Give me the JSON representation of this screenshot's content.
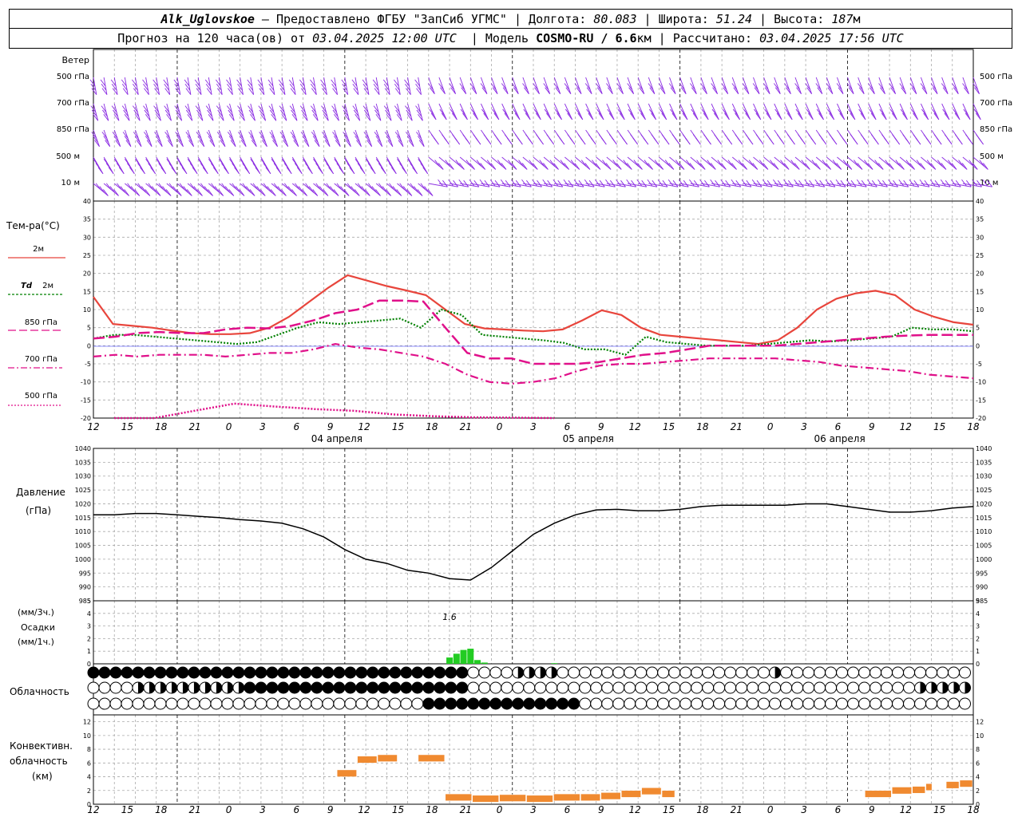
{
  "header": {
    "station": "Alk_Uglovskoe",
    "provider": " – Предоставлено ФГБУ \"ЗапСиб УГМС\" | Долгота: ",
    "lon": "80.083",
    "lat_label": " | Широта: ",
    "lat": "51.24",
    "alt_label": " | Высота: ",
    "alt": "187",
    "alt_unit": "м",
    "forecast_label": "Прогноз на 120 часа(ов) от ",
    "forecast_time": "03.04.2025 12:00 UTC",
    "model_label": "  | Модель ",
    "model": "COSMO-RU / 6.6",
    "model_unit": "км",
    "calc_label": " | Рассчитано: ",
    "calc_time": "03.04.2025 17:56 UTC"
  },
  "labels": {
    "wind": "Ветер",
    "levels": [
      "500 гПа",
      "700 гПа",
      "850 гПа",
      "500 м",
      "10 м"
    ],
    "temp_title": "Тем-ра(°С)",
    "t2m": "2м",
    "td_sym": "Td",
    "td_2m": "2м",
    "t850": "850 гПа",
    "t700": "700 гПа",
    "t500": "500 гПа",
    "pressure": "Давление",
    "pressure_unit": "(гПа)",
    "precip_unit1": "(мм/3ч.)",
    "precip": "Осадки",
    "precip_unit2": "(мм/1ч.)",
    "precip_peak": "1.6",
    "cloud": "Облачность",
    "conv1": "Конвективн.",
    "conv2": "облачность",
    "conv3": "(км)",
    "dates": [
      "04 апреля",
      "05 апреля",
      "06 апреля"
    ],
    "hour_ticks": [
      "12",
      "15",
      "18",
      "21",
      "0",
      "3",
      "6",
      "9",
      "12",
      "15",
      "18",
      "21",
      "0",
      "3",
      "6",
      "9",
      "12",
      "15",
      "18",
      "21",
      "0",
      "3",
      "6",
      "9",
      "12",
      "15",
      "18"
    ]
  },
  "colors": {
    "t2m": "#e8453c",
    "td2m": "#008000",
    "t_upper": "#e0108a",
    "wind": "#8a2be2",
    "precip": "#22cc22",
    "convective": "#f08a30"
  },
  "chart_data": [
    {
      "type": "line",
      "name": "temperature",
      "x_hours": [
        0,
        3,
        6,
        9,
        12,
        15,
        18,
        21,
        24,
        27,
        30,
        33,
        36,
        39,
        42,
        45,
        48,
        51,
        54,
        57,
        60,
        63,
        66,
        69,
        72,
        75,
        78,
        81,
        84,
        87,
        90,
        93,
        96,
        99,
        102,
        105,
        108,
        111,
        114,
        117,
        120,
        123,
        126
      ],
      "series": [
        {
          "name": "2м",
          "values": [
            13.5,
            6,
            5.5,
            5,
            4.2,
            3.5,
            3.2,
            3.2,
            3.5,
            5,
            8,
            12,
            16,
            19.5,
            18,
            16.5,
            15.3,
            14,
            10,
            6,
            4.8,
            4.5,
            4.2,
            4,
            4.5,
            7,
            9.8,
            8.5,
            5,
            3,
            2.5,
            2,
            1.5,
            1,
            0.5,
            1.5,
            5,
            10,
            13,
            14.5,
            15.2,
            14,
            10,
            8,
            6.5,
            5.8
          ]
        },
        {
          "name": "Td 2м",
          "values": [
            2,
            3,
            3,
            2.5,
            2,
            1.5,
            1,
            0.5,
            1,
            3,
            5,
            6.5,
            6,
            6.5,
            7,
            7.5,
            5,
            10,
            8.5,
            3,
            2.5,
            2,
            1.5,
            0.8,
            -1,
            -1,
            -2.5,
            2.5,
            1,
            0.5,
            0,
            0,
            0,
            0.5,
            1,
            1.5,
            1.2,
            1.5,
            2,
            2.5,
            5,
            4.5,
            4.5,
            4
          ]
        },
        {
          "name": "850 гПа",
          "values": [
            2,
            2.5,
            3.5,
            3.8,
            3.5,
            3.5,
            4.5,
            5,
            4.8,
            5.5,
            7,
            9,
            10,
            12.5,
            12.5,
            12.2,
            5,
            -2,
            -3.5,
            -3.5,
            -5,
            -5,
            -5,
            -4.5,
            -3.5,
            -2.5,
            -2,
            -1,
            0,
            0,
            0,
            0,
            0.5,
            1,
            1.5,
            2,
            2.5,
            2.8,
            3,
            3,
            3
          ]
        },
        {
          "name": "700 гПа",
          "values": [
            -3,
            -2.5,
            -3,
            -2.5,
            -2.5,
            -2.5,
            -3,
            -2.5,
            -2,
            -2,
            -1,
            0.5,
            -0.5,
            -1,
            -2,
            -3,
            -5,
            -8,
            -10,
            -10.5,
            -10,
            -9,
            -7,
            -5.5,
            -5,
            -5,
            -4.5,
            -4,
            -3.5,
            -3.5,
            -3.5,
            -3.5,
            -4,
            -4.5,
            -5.5,
            -6,
            -6.5,
            -7,
            -8,
            -8.5,
            -9
          ]
        },
        {
          "name": "500 гПа",
          "values": [
            -20,
            -20,
            -18,
            -16,
            -16.8,
            -17.5,
            -18,
            -19,
            -19.5,
            -19.8,
            -19.9,
            -20
          ]
        }
      ],
      "ylim": [
        -20,
        40
      ],
      "yticks": [
        -20,
        -15,
        -10,
        -5,
        0,
        5,
        10,
        15,
        20,
        25,
        30,
        35,
        40
      ]
    },
    {
      "type": "line",
      "name": "pressure",
      "x_hours": [
        0,
        3,
        6,
        9,
        12,
        15,
        18,
        21,
        24,
        27,
        30,
        33,
        36,
        39,
        42,
        45,
        48,
        51,
        54,
        57,
        60,
        63,
        66,
        69,
        72,
        75,
        78,
        81,
        84,
        87,
        90,
        93,
        96,
        99,
        102,
        105,
        108,
        111,
        114,
        117,
        120,
        123,
        126
      ],
      "values": [
        1016,
        1016,
        1016.5,
        1016.5,
        1016,
        1015.5,
        1015,
        1014.3,
        1013.8,
        1013,
        1011,
        1008,
        1003.5,
        1000,
        998.5,
        996,
        995,
        993,
        992.5,
        997,
        1003,
        1009,
        1013,
        1016,
        1017.8,
        1018,
        1017.5,
        1017.5,
        1018,
        1019,
        1019.5,
        1019.5,
        1019.5,
        1019.5,
        1020,
        1020,
        1019,
        1018,
        1017,
        1017,
        1017.5,
        1018.5,
        1019
      ],
      "ylim": [
        985,
        1040
      ],
      "yticks": [
        985,
        990,
        995,
        1000,
        1005,
        1010,
        1015,
        1020,
        1025,
        1030,
        1035,
        1040
      ]
    },
    {
      "type": "bar",
      "name": "precipitation",
      "x_hours": [
        51,
        52,
        53,
        54,
        55,
        56,
        66
      ],
      "values": [
        0.5,
        0.8,
        1.1,
        1.2,
        0.3,
        0.1,
        0.05
      ],
      "ylim": [
        0,
        5
      ],
      "yticks": [
        0,
        1,
        2,
        3,
        4,
        5
      ]
    },
    {
      "type": "bar",
      "name": "convective",
      "bars": [
        {
          "x": [
            36,
            39
          ],
          "top": 5.0
        },
        {
          "x": [
            39,
            42
          ],
          "top": 7.0
        },
        {
          "x": [
            42,
            45
          ],
          "top": 7.2
        },
        {
          "x": [
            48,
            52
          ],
          "top": 7.2
        },
        {
          "x": [
            52,
            56
          ],
          "top": 1.5
        },
        {
          "x": [
            56,
            60
          ],
          "top": 1.3
        },
        {
          "x": [
            60,
            64
          ],
          "top": 1.4
        },
        {
          "x": [
            64,
            68
          ],
          "top": 1.3
        },
        {
          "x": [
            68,
            72
          ],
          "top": 1.5
        },
        {
          "x": [
            72,
            75
          ],
          "top": 1.5
        },
        {
          "x": [
            75,
            78
          ],
          "top": 1.7
        },
        {
          "x": [
            78,
            81
          ],
          "top": 2.0
        },
        {
          "x": [
            81,
            84
          ],
          "top": 2.4
        },
        {
          "x": [
            84,
            86
          ],
          "top": 2.0
        },
        {
          "x": [
            114,
            118
          ],
          "top": 2.0
        },
        {
          "x": [
            118,
            121
          ],
          "top": 2.5
        },
        {
          "x": [
            121,
            123
          ],
          "top": 2.6
        },
        {
          "x": [
            123,
            124
          ],
          "top": 3.0
        },
        {
          "x": [
            126,
            128
          ],
          "top": 3.3
        },
        {
          "x": [
            128,
            130
          ],
          "top": 3.5
        }
      ],
      "ylim": [
        0,
        13
      ],
      "yticks": [
        0,
        2,
        4,
        6,
        8,
        10,
        12
      ]
    }
  ]
}
